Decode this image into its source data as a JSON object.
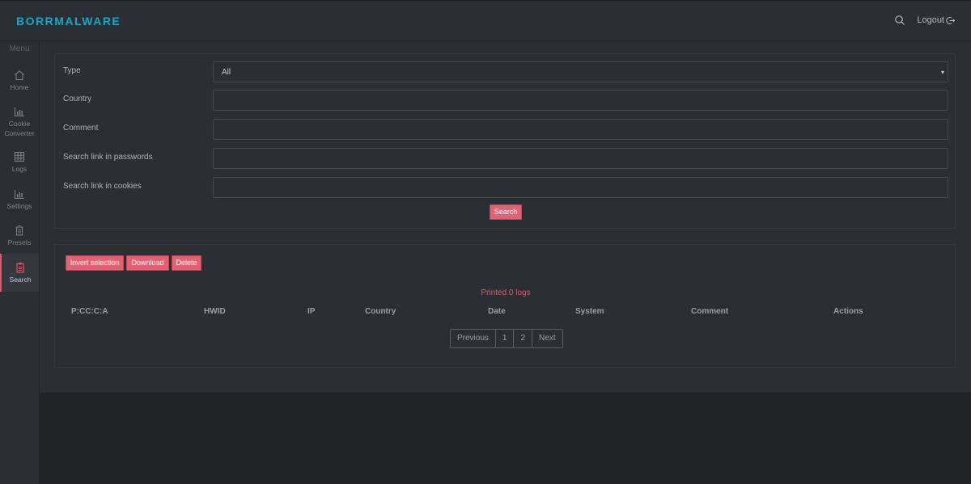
{
  "app": {
    "brand": "BORRMALWARE"
  },
  "topbar": {
    "logout_label": "Logout",
    "search_icon": "search-icon",
    "logout_icon": "logout-icon"
  },
  "sidebar": {
    "menu_title": "Menu",
    "items": [
      {
        "label": "Home",
        "icon": "home-icon"
      },
      {
        "label": "Cookie Converter",
        "icon": "chart-icon"
      },
      {
        "label": "Logs",
        "icon": "grid-icon"
      },
      {
        "label": "Settings",
        "icon": "chart-icon"
      },
      {
        "label": "Presets",
        "icon": "trash-icon"
      },
      {
        "label": "Search",
        "icon": "clipboard-icon",
        "active": true
      }
    ]
  },
  "filters": {
    "type_label": "Type",
    "type_value": "All",
    "country_label": "Country",
    "country_value": "",
    "comment_label": "Comment",
    "comment_value": "",
    "passwords_label": "Search link in passwords",
    "passwords_value": "",
    "cookies_label": "Search link in cookies",
    "cookies_value": "",
    "search_button": "Search"
  },
  "results": {
    "invert_label": "Invert selection",
    "download_label": "Download",
    "delete_label": "Delete",
    "status": "Printed 0 logs",
    "columns": [
      "P:CC:C:A",
      "HWID",
      "IP",
      "Country",
      "Date",
      "System",
      "Comment",
      "Actions"
    ],
    "rows": [],
    "pagination": [
      "Previous",
      "1",
      "2",
      "Next"
    ]
  },
  "colors": {
    "accent": "#df6374",
    "brand": "#1aa6c8",
    "background": "#2b2e33"
  }
}
